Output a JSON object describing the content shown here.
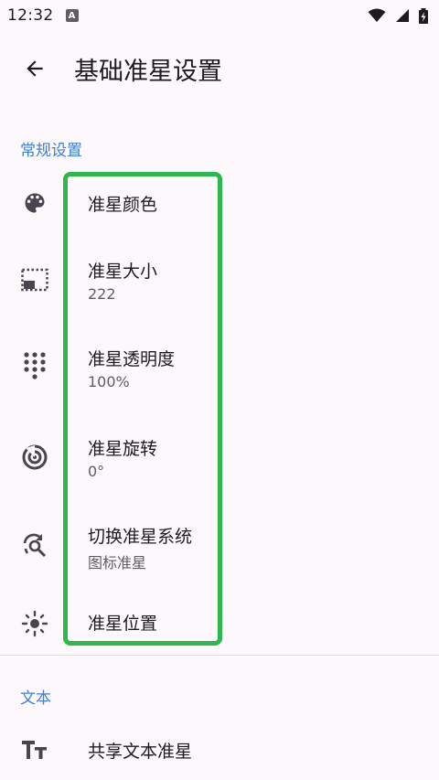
{
  "status_bar": {
    "time": "12:32",
    "app_icon": "A",
    "icons": [
      "wifi-icon",
      "signal-icon",
      "battery-charging-icon"
    ]
  },
  "top_bar": {
    "back_icon": "arrow-back-icon",
    "title": "基础准星设置"
  },
  "sections": [
    {
      "header": "常规设置",
      "items": [
        {
          "icon": "palette-icon",
          "title": "准星颜色",
          "summary": ""
        },
        {
          "icon": "picture-in-picture-icon",
          "title": "准星大小",
          "summary": "222"
        },
        {
          "icon": "dialpad-icon",
          "title": "准星透明度",
          "summary": "100%"
        },
        {
          "icon": "radar-icon",
          "title": "准星旋转",
          "summary": "0°"
        },
        {
          "icon": "sync-search-icon",
          "title": "切换准星系统",
          "summary": "图标准星"
        },
        {
          "icon": "position-sun-icon",
          "title": "准星位置",
          "summary": ""
        }
      ]
    },
    {
      "header": "文本",
      "items": [
        {
          "icon": "text-size-icon",
          "title": "共享文本准星",
          "summary": ""
        }
      ]
    }
  ],
  "colors": {
    "background": "#fcf8fc",
    "accent": "#3d7fd6",
    "highlight": "#2cb84a",
    "icon": "#49454f"
  }
}
